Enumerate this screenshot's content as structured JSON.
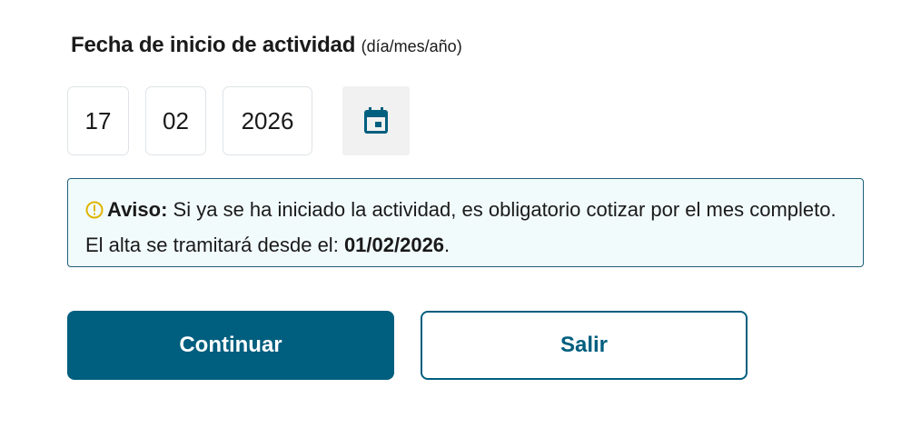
{
  "form": {
    "label": "Fecha de inicio de actividad",
    "label_hint": "(día/mes/año)",
    "day": "17",
    "month": "02",
    "year": "2026"
  },
  "notice": {
    "title": "Aviso:",
    "text": "Si ya se ha iniciado la actividad, es obligatorio cotizar por el mes completo. El alta se tramitará desde el:",
    "date": "01/02/2026",
    "end": "."
  },
  "buttons": {
    "continue": "Continuar",
    "exit": "Salir"
  },
  "colors": {
    "primary": "#005e7e",
    "notice_border": "#1f6077",
    "notice_bg": "#f2fbfc",
    "warning": "#e0b400"
  },
  "icons": {
    "calendar": "calendar-icon",
    "warning": "warning-icon"
  }
}
